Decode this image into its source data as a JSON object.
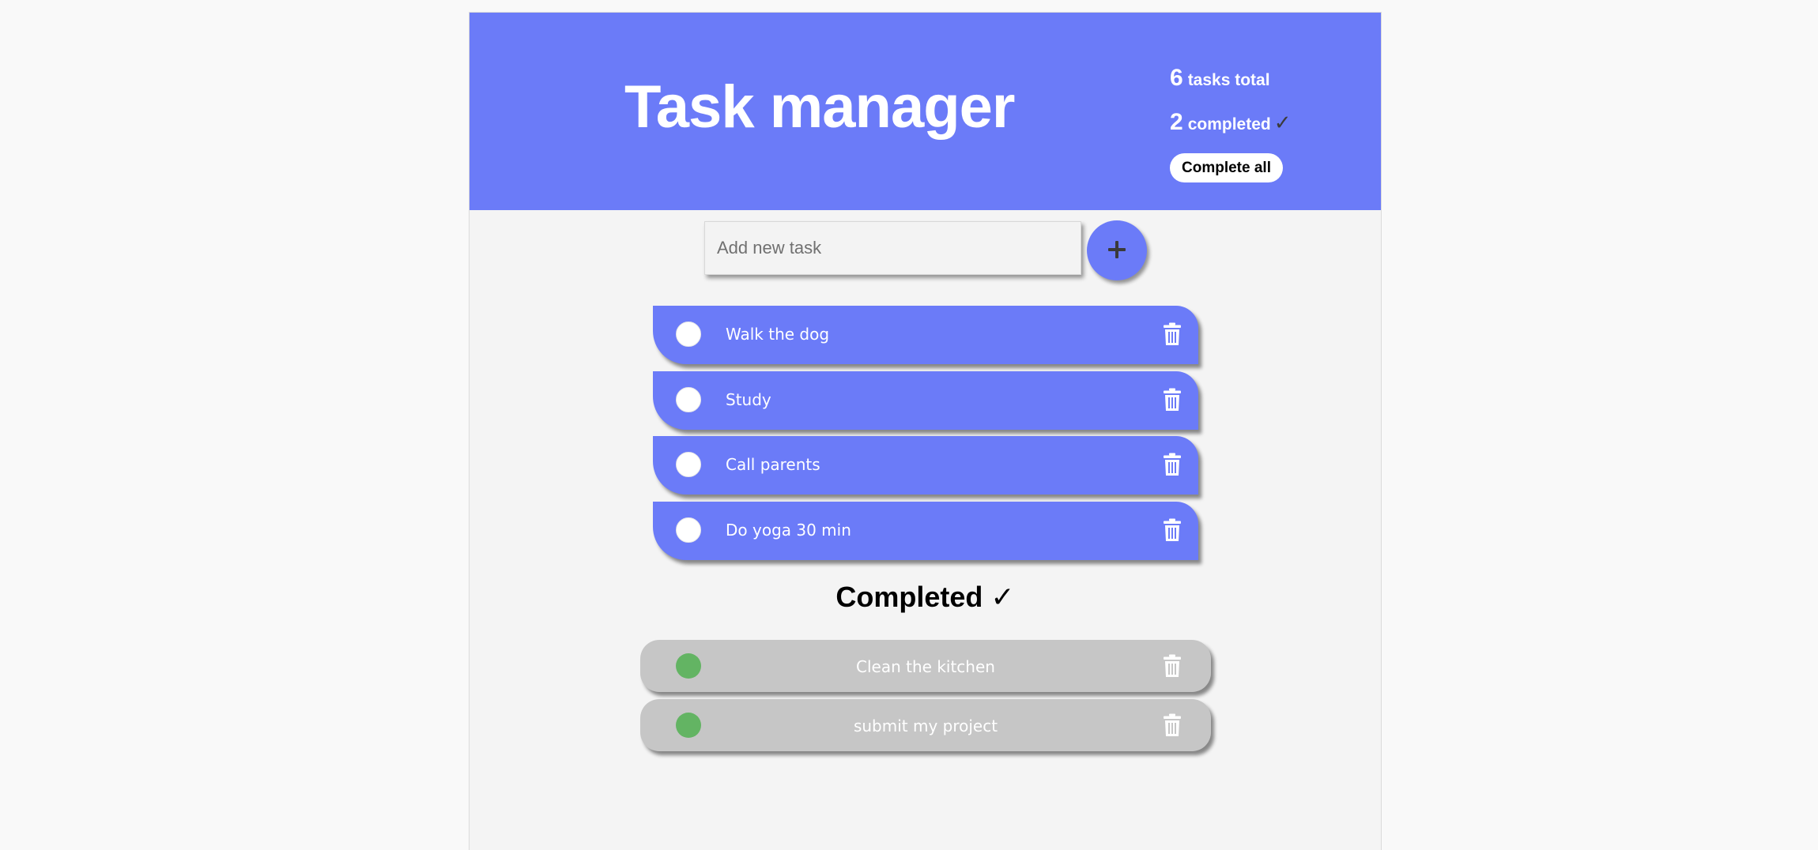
{
  "header": {
    "title": "Task manager",
    "total_count": "6",
    "total_label": "tasks total",
    "completed_count": "2",
    "completed_label": "completed",
    "check_glyph": "✓",
    "complete_all_label": "Complete all",
    "background_color": "#6b7bf8"
  },
  "new_task": {
    "placeholder": "Add new task",
    "value": "",
    "add_button_icon": "plus-icon"
  },
  "tasks": [
    {
      "label": "Walk the dog",
      "done": false
    },
    {
      "label": "Study",
      "done": false
    },
    {
      "label": "Call parents",
      "done": false
    },
    {
      "label": "Do yoga 30 min",
      "done": false
    }
  ],
  "completed_section": {
    "heading": "Completed ✓",
    "items": [
      {
        "label": "Clean the kitchen",
        "done": true
      },
      {
        "label": "submit my project",
        "done": true
      }
    ]
  },
  "colors": {
    "accent": "#6b7bf8",
    "completed_item": "#c6c6c6",
    "done_check": "#63b463"
  }
}
